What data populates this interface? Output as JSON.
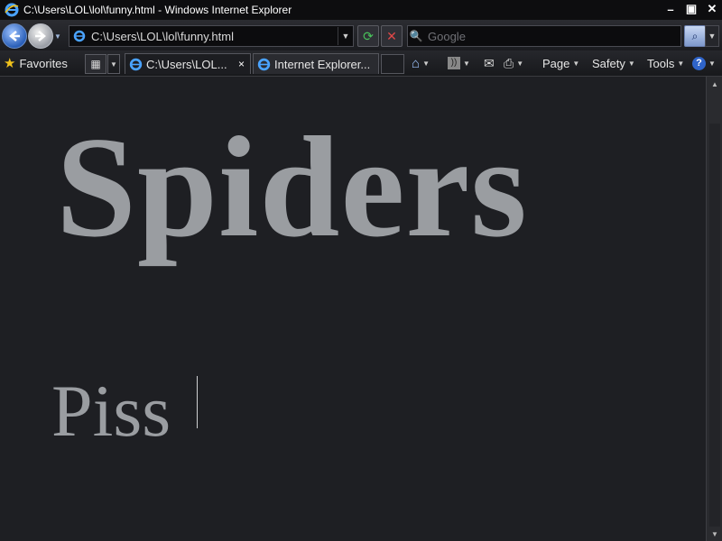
{
  "window": {
    "title": "C:\\Users\\LOL\\lol\\funny.html - Windows Internet Explorer",
    "controls": {
      "minimize": "–",
      "restore": "▣",
      "close": "✕"
    }
  },
  "nav": {
    "address": "C:\\Users\\LOL\\lol\\funny.html",
    "search_placeholder": "Google"
  },
  "command_bar": {
    "favorites_label": "Favorites",
    "tabs": [
      {
        "label": "C:\\Users\\LOL...",
        "close": "×"
      },
      {
        "label": "Internet Explorer..."
      }
    ],
    "page_label": "Page",
    "safety_label": "Safety",
    "tools_label": "Tools"
  },
  "content": {
    "heading": "Spiders",
    "subtext": "Piss"
  },
  "colors": {
    "page_background": "#1e1f23",
    "text_gray": "#9a9da1",
    "chrome_dark": "#0d0d0f"
  },
  "icons": [
    "ie-logo-icon",
    "back-arrow-icon",
    "forward-arrow-icon",
    "page-icon",
    "refresh-icon",
    "stop-icon",
    "search-icon",
    "star-icon",
    "quick-tabs-icon",
    "home-icon",
    "rss-icon",
    "mail-icon",
    "print-icon",
    "help-icon"
  ]
}
